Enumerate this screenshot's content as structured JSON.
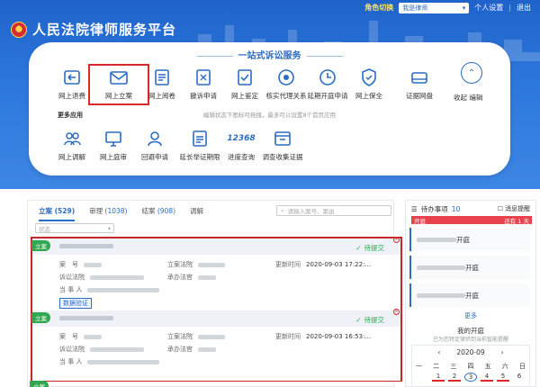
{
  "header": {
    "app_title": "人民法院律师服务平台",
    "role_switch_label": "角色切换",
    "role_value": "我是律师",
    "personal_settings": "个人设置",
    "logout": "退出"
  },
  "services": {
    "card_title": "一站式诉讼服务",
    "top_row": [
      {
        "label": "网上退费",
        "icon": "refund-icon"
      },
      {
        "label": "网上立案",
        "icon": "mail-icon"
      },
      {
        "label": "网上阅卷",
        "icon": "document-icon"
      },
      {
        "label": "撤诉申请",
        "icon": "withdraw-icon"
      },
      {
        "label": "网上鉴定",
        "icon": "appraisal-icon"
      },
      {
        "label": "核实代理关系",
        "icon": "verify-icon"
      },
      {
        "label": "延期开庭申请",
        "icon": "clock-icon"
      },
      {
        "label": "网上保全",
        "icon": "shield-icon"
      },
      {
        "label": "证据网盘",
        "icon": "cloud-drive-icon"
      }
    ],
    "collapse_label": "收起",
    "edit_label": "编辑",
    "more_apps_label": "更多应用",
    "edit_hint": "编辑状态下图标可拖拽，最多可以设置8个首页应用",
    "bottom_row": [
      {
        "label": "网上调解",
        "icon": "mediation-icon"
      },
      {
        "label": "网上庭审",
        "icon": "trial-icon"
      },
      {
        "label": "回避申请",
        "icon": "avoid-icon"
      },
      {
        "label": "延长举证期限",
        "icon": "extend-icon"
      },
      {
        "label": "进度查询",
        "icon": "hotline-12368-icon",
        "badge": "12368"
      },
      {
        "label": "调查收集证据",
        "icon": "evidence-icon"
      }
    ]
  },
  "list": {
    "tabs": [
      {
        "label": "立案",
        "count": "(529)"
      },
      {
        "label": "审理",
        "count": "(1038)"
      },
      {
        "label": "结案",
        "count": "(908)"
      },
      {
        "label": "调解",
        "count": ""
      }
    ],
    "search_placeholder": "请输入案号、案由",
    "status_placeholder": "状态",
    "cases": [
      {
        "tag": "立案",
        "status": "待提交",
        "labels": {
          "case_no": "案　号",
          "court": "立案法院",
          "time": "更新时间",
          "cause": "诉讼法院",
          "law": "承办法官",
          "party": "当 事 人"
        },
        "update_time": "2020-09-03 17:22:...",
        "verify_tag": "数据验证"
      },
      {
        "tag": "立案",
        "status": "待提交",
        "labels": {
          "case_no": "案　号",
          "court": "立案法院",
          "time": "更新时间",
          "cause": "诉讼法院",
          "law": "承办法官",
          "party": "当 事 人"
        },
        "update_time": "2020-09-03 16:53:...",
        "verify_tag": ""
      }
    ],
    "next_tag": "立案"
  },
  "todo": {
    "title": "待办事项",
    "count": "10",
    "reminder_label": "消息提醒",
    "bar_left": "开庭",
    "bar_right": "还有 1 天",
    "items": [
      "开庭",
      "开庭",
      "开庭"
    ],
    "more": "更多",
    "court_title": "我的开庭",
    "court_sub": "已为您特定律师到当前智能提醒",
    "calendar": {
      "month": "2020-09",
      "weekdays": [
        "一",
        "二",
        "三",
        "四",
        "五",
        "六",
        "日"
      ],
      "days": [
        "1",
        "2",
        "3",
        "4",
        "5",
        "6"
      ]
    }
  },
  "colors": {
    "brand_blue": "#2b6cc4",
    "highlight_red": "#d9292a",
    "success_green": "#2fa84f"
  }
}
